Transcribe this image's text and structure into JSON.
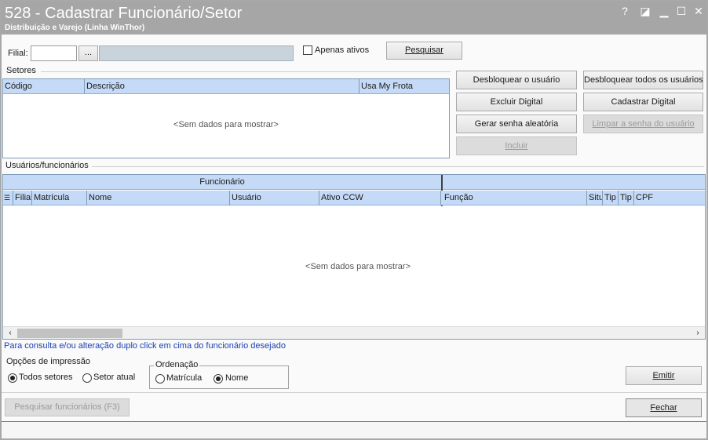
{
  "window": {
    "title": "528 - Cadastrar Funcionário/Setor",
    "subtitle": "Distribuição e Varejo (Linha WinThor)",
    "controls": {
      "help": "?",
      "edit": "◪",
      "minimize": "▁",
      "maximize": "☐",
      "close": "✕"
    }
  },
  "filter": {
    "filial_label": "Filial:",
    "filial_value": "",
    "lookup_label": "...",
    "filial_name": "",
    "apenas_ativos_label": "Apenas ativos",
    "apenas_ativos_checked": false,
    "pesquisar_label": "Pesquisar"
  },
  "setores": {
    "group_label": "Setores",
    "columns": [
      "Código",
      "Descrição",
      "Usa My Frota"
    ],
    "empty_text": "<Sem dados para mostrar>"
  },
  "actions": {
    "desbloquear_usuario": "Desbloquear o usuário",
    "desbloquear_todos": "Desbloquear todos os usuários",
    "excluir_digital": "Excluir Digital",
    "cadastrar_digital": "Cadastrar Digital",
    "gerar_senha": "Gerar senha aleatória",
    "limpar_senha": "Limpar a senha do usuário",
    "incluir": "Incluir"
  },
  "usuarios": {
    "group_label": "Usuários/funcionários",
    "band_funcionario": "Funcionário",
    "band_right": "",
    "columns_left": [
      "Filial",
      "Matrícula",
      "Nome",
      "Usuário",
      "Ativo CCW"
    ],
    "columns_right": [
      "Função",
      "Situ",
      "Tip",
      "Tip",
      "CPF"
    ],
    "empty_text": "<Sem dados para mostrar>",
    "hint": "Para consulta e/ou alteração duplo click em cima do funcionário desejado"
  },
  "impressao": {
    "group_label": "Opções de impressão",
    "todos_setores": "Todos setores",
    "setor_atual": "Setor atual",
    "selected": "Todos setores",
    "ordenacao_label": "Ordenação",
    "matricula": "Matrícula",
    "nome": "Nome",
    "ordenacao_selected": "Nome",
    "emitir": "Emitir"
  },
  "footer": {
    "pesquisar_funcionarios": "Pesquisar funcionários (F3)",
    "fechar": "Fechar"
  },
  "colors": {
    "titlebar": "#a6a6a6",
    "grid_header": "#c5daf6",
    "hint_text": "#1a3fb0"
  }
}
